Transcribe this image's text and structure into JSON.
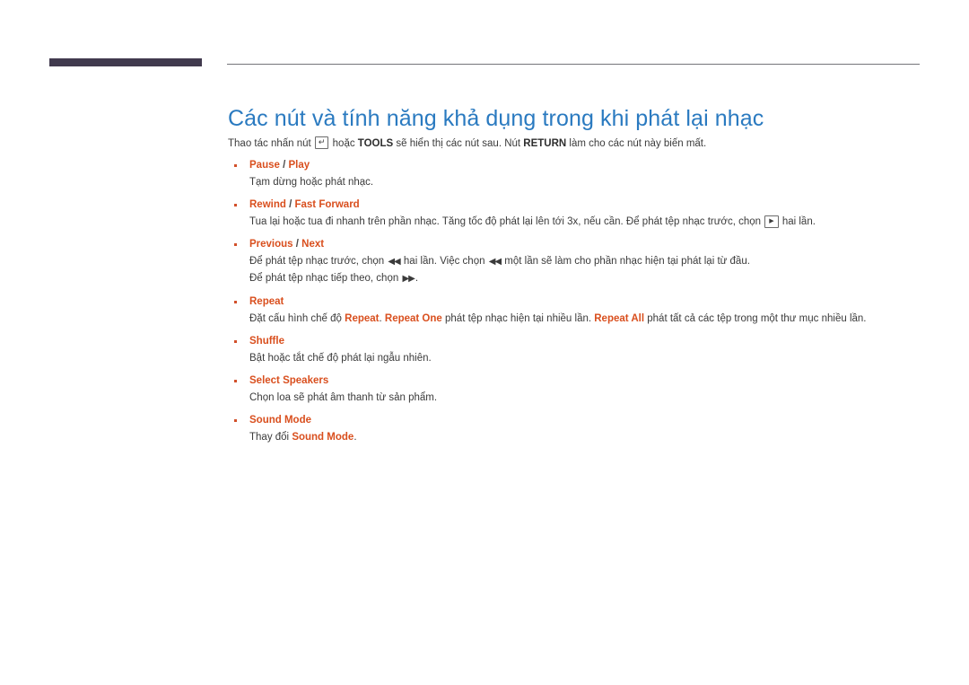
{
  "header": {
    "accent_bar_color": "#413a4e",
    "rule_color": "#75757a"
  },
  "title": "Các nút và tính năng khả dụng trong khi phát lại nhạc",
  "title_color": "#2a7ac0",
  "accent_color": "#d94f1e",
  "intro": {
    "part1": "Thao tác nhấn nút ",
    "enter_icon": "↵",
    "part2": " hoặc ",
    "tools": "TOOLS",
    "part3": " sẽ hiển thị các nút sau. Nút ",
    "return": "RETURN",
    "part4": " làm cho các nút này biến mất."
  },
  "items": [
    {
      "heading_a": "Pause",
      "separator": " / ",
      "heading_b": "Play",
      "desc_lines": [
        {
          "segments": [
            {
              "text": "Tạm dừng hoặc phát nhạc.",
              "style": "plain"
            }
          ]
        }
      ]
    },
    {
      "heading_a": "Rewind",
      "separator": " / ",
      "heading_b": "Fast Forward",
      "desc_lines": [
        {
          "segments": [
            {
              "text": "Tua lại hoặc tua đi nhanh trên phần nhạc. Tăng tốc độ phát lại lên tới 3x, nếu cần. Để phát tệp nhạc trước, chọn ",
              "style": "plain"
            },
            {
              "text": "▶",
              "style": "key-play"
            },
            {
              "text": " hai lần.",
              "style": "plain"
            }
          ]
        }
      ]
    },
    {
      "heading_a": "Previous",
      "separator": " / ",
      "heading_b": "Next",
      "desc_lines": [
        {
          "segments": [
            {
              "text": "Để phát tệp nhạc trước, chọn ",
              "style": "plain"
            },
            {
              "text": "◀◀",
              "style": "glyph"
            },
            {
              "text": " hai lần. Việc chọn ",
              "style": "plain"
            },
            {
              "text": "◀◀",
              "style": "glyph"
            },
            {
              "text": " một lần sẽ làm cho phần nhạc hiện tại phát lại từ đầu.",
              "style": "plain"
            }
          ]
        },
        {
          "segments": [
            {
              "text": "Để phát tệp nhạc tiếp theo, chọn ",
              "style": "plain"
            },
            {
              "text": "▶▶",
              "style": "glyph"
            },
            {
              "text": ".",
              "style": "plain"
            }
          ]
        }
      ]
    },
    {
      "heading_a": "Repeat",
      "separator": "",
      "heading_b": "",
      "desc_lines": [
        {
          "segments": [
            {
              "text": "Đặt cấu hình chế độ ",
              "style": "plain"
            },
            {
              "text": "Repeat",
              "style": "hl"
            },
            {
              "text": ". ",
              "style": "plain"
            },
            {
              "text": "Repeat One",
              "style": "hl"
            },
            {
              "text": " phát tệp nhạc hiện tại nhiều lần. ",
              "style": "plain"
            },
            {
              "text": "Repeat All",
              "style": "hl"
            },
            {
              "text": " phát tất cả các tệp trong một thư mục nhiều lần.",
              "style": "plain"
            }
          ]
        }
      ]
    },
    {
      "heading_a": "Shuffle",
      "separator": "",
      "heading_b": "",
      "desc_lines": [
        {
          "segments": [
            {
              "text": "Bật hoặc tắt chế độ phát lại ngẫu nhiên.",
              "style": "plain"
            }
          ]
        }
      ]
    },
    {
      "heading_a": "Select Speakers",
      "separator": "",
      "heading_b": "",
      "desc_lines": [
        {
          "segments": [
            {
              "text": "Chọn loa sẽ phát âm thanh từ sản phẩm.",
              "style": "plain"
            }
          ]
        }
      ]
    },
    {
      "heading_a": "Sound Mode",
      "separator": "",
      "heading_b": "",
      "desc_lines": [
        {
          "segments": [
            {
              "text": "Thay đổi ",
              "style": "plain"
            },
            {
              "text": "Sound Mode",
              "style": "hl"
            },
            {
              "text": ".",
              "style": "plain"
            }
          ]
        }
      ]
    }
  ]
}
